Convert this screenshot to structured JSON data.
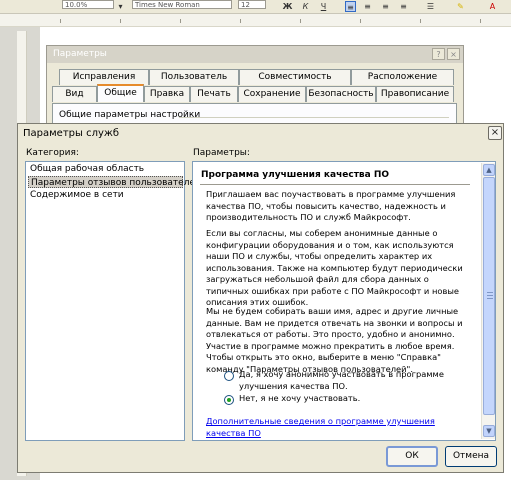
{
  "toolbar": {
    "size_field": "10.0%",
    "font_field": "Times New Roman",
    "font_size_field": "12"
  },
  "background_dialog": {
    "title": "Параметры",
    "help_button": "?",
    "close_button": "×",
    "tabs_row1": [
      "Исправления",
      "Пользователь",
      "Совместимость",
      "Расположение"
    ],
    "tabs_row2": [
      "Вид",
      "Общие",
      "Правка",
      "Печать",
      "Сохранение",
      "Безопасность",
      "Правописание"
    ],
    "active_tab": "Общие",
    "panel_heading": "Общие параметры настройки"
  },
  "dialog": {
    "title": "Параметры служб",
    "close_button": "×",
    "categories_label": "Категория:",
    "categories": [
      "Общая рабочая область",
      "Параметры отзывов пользователей",
      "Содержимое в сети"
    ],
    "selected_category": 1,
    "params_label": "Параметры:",
    "section_title": "Программа улучшения качества ПО",
    "paragraph1": "Приглашаем вас поучаствовать в программе улучшения качества ПО, чтобы повысить качество, надежность и производительность ПО и служб Майкрософт.",
    "paragraph2": "Если вы согласны, мы соберем анонимные данные о конфигурации оборудования и о том, как используются наши ПО и службы, чтобы определить характер их использования. Также на компьютер будут периодически загружаться небольшой файл для сбора данных о типичных ошибках при работе с ПО Майкрософт и новые описания этих ошибок.",
    "paragraph3": "Мы не будем собирать ваши имя, адрес и другие личные данные. Вам не придется отвечать на звонки и вопросы и отвлекаться от работы. Это просто, удобно и анонимно. Участие в программе можно прекратить в любое время. Чтобы открыть это окно, выберите в меню \"Справка\" команду \"Параметры отзывов пользователей\".",
    "option_yes": "Да, я хочу анонимно участвовать в программе улучшения качества ПО.",
    "option_no": "Нет, я не хочу участвовать.",
    "selected_option": "no",
    "more_info_link": "Дополнительные сведения о программе улучшения качества ПО",
    "ok_button": "ОК",
    "cancel_button": "Отмена"
  },
  "colors": {
    "dialog_bg": "#ece9d8",
    "active_tab_accent": "#e68b2c",
    "link": "#0000ee",
    "radio_dot": "#21a121"
  }
}
